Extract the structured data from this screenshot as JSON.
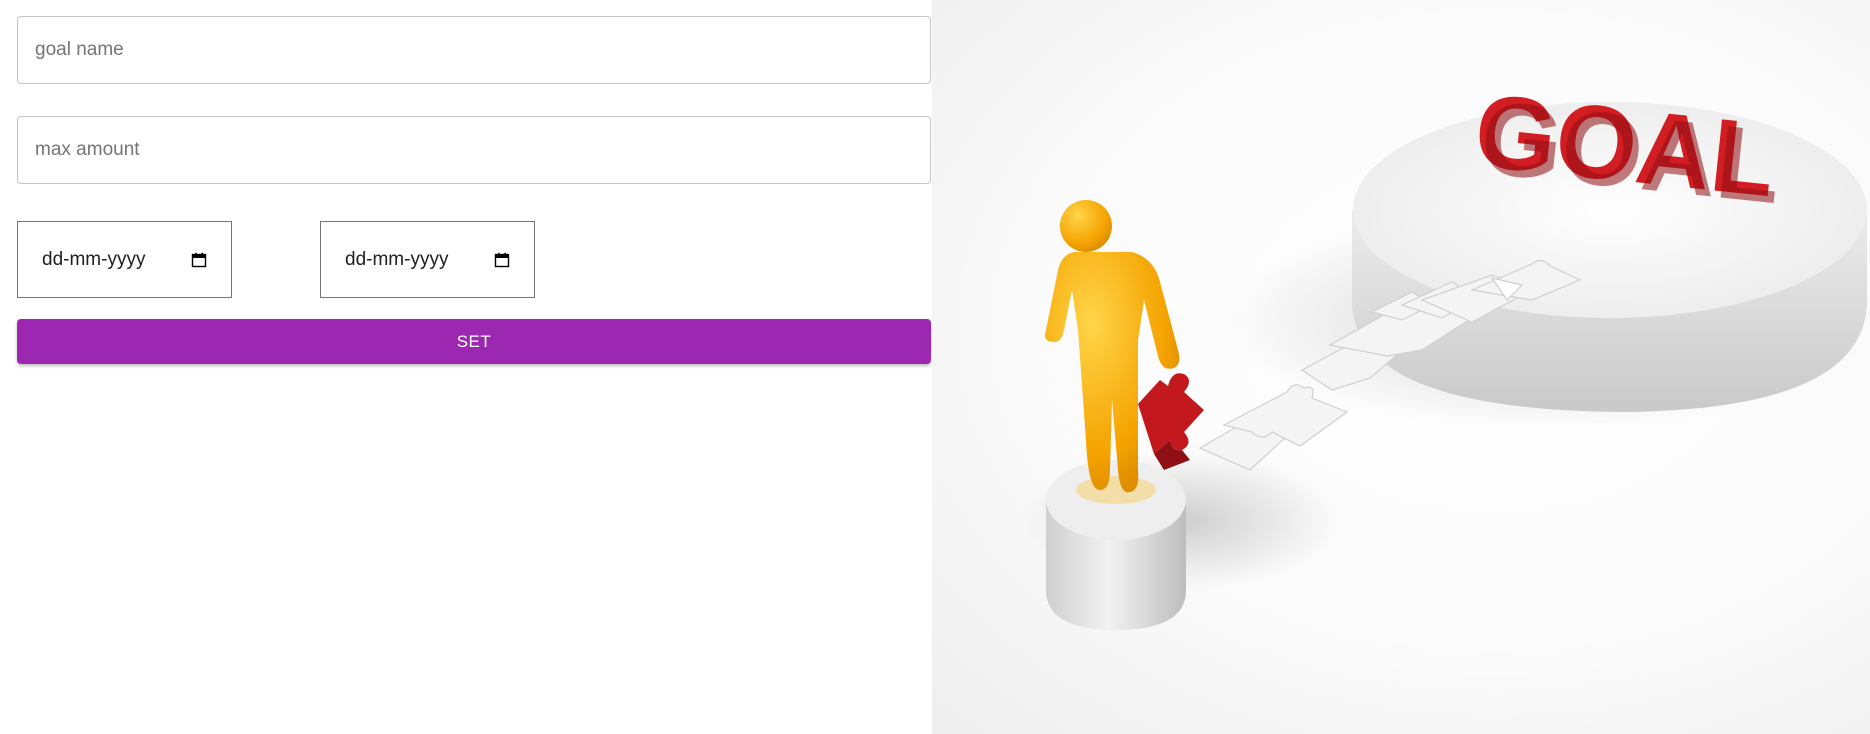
{
  "form": {
    "goal_name_placeholder": "goal name",
    "max_amount_placeholder": "max amount",
    "start_date_placeholder": "dd-mm-yyyy",
    "end_date_placeholder": "dd-mm-yyyy",
    "set_label": "SET"
  },
  "illustration": {
    "goal_text": "GOAL",
    "colors": {
      "figure": "#f5a300",
      "puzzle_red": "#c3191e",
      "goal_red": "#d21d22",
      "pedestal": "#e2e2e2",
      "puzzle_white": "#f4f4f4"
    }
  },
  "theme": {
    "accent": "#9c27b0"
  }
}
